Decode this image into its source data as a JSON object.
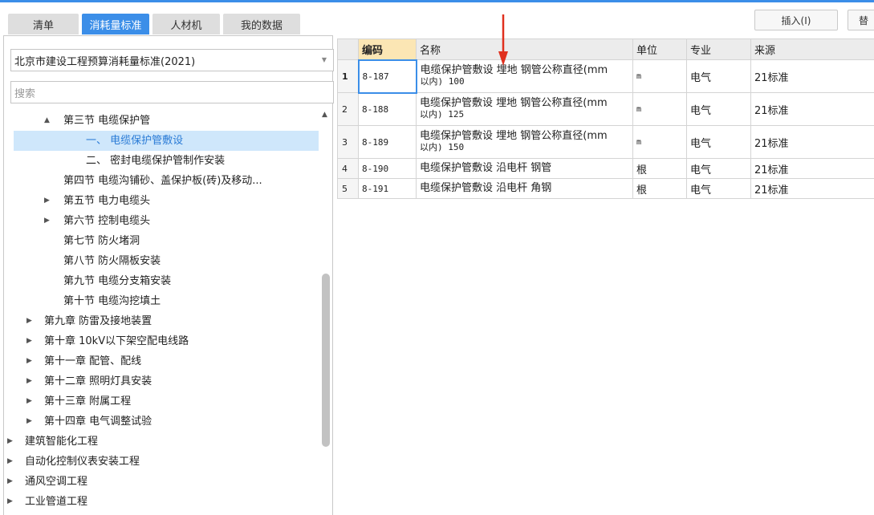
{
  "tabs": [
    "清单",
    "消耗量标准",
    "人材机",
    "我的数据"
  ],
  "active_tab": 1,
  "toolbar": {
    "insert_label": "插入(I)",
    "replace_label": "替"
  },
  "left_panel": {
    "standard_select": "北京市建设工程预算消耗量标准(2021)",
    "search_placeholder": "搜索",
    "tree": [
      {
        "label": "第三节 电缆保护管",
        "arrow": "▲",
        "level": 3,
        "expanded": true
      },
      {
        "label": "一、 电缆保护管敷设",
        "level": 4,
        "selected": true
      },
      {
        "label": "二、 密封电缆保护管制作安装",
        "level": 4
      },
      {
        "label": "第四节 电缆沟铺砂、盖保护板(砖)及移动...",
        "level": 3
      },
      {
        "label": "第五节 电力电缆头",
        "arrow": "▶",
        "level": 3
      },
      {
        "label": "第六节 控制电缆头",
        "arrow": "▶",
        "level": 3
      },
      {
        "label": "第七节 防火堵洞",
        "level": 3
      },
      {
        "label": "第八节 防火隔板安装",
        "level": 3
      },
      {
        "label": "第九节 电缆分支箱安装",
        "level": 3
      },
      {
        "label": "第十节 电缆沟挖填土",
        "level": 3
      },
      {
        "label": "第九章 防雷及接地装置",
        "arrow": "▶",
        "level": 2
      },
      {
        "label": "第十章 10kV以下架空配电线路",
        "arrow": "▶",
        "level": 2
      },
      {
        "label": "第十一章 配管、配线",
        "arrow": "▶",
        "level": 2
      },
      {
        "label": "第十二章 照明灯具安装",
        "arrow": "▶",
        "level": 2
      },
      {
        "label": "第十三章 附属工程",
        "arrow": "▶",
        "level": 2
      },
      {
        "label": "第十四章 电气调整试验",
        "arrow": "▶",
        "level": 2
      },
      {
        "label": "建筑智能化工程",
        "arrow": "▶",
        "level": 1
      },
      {
        "label": "自动化控制仪表安装工程",
        "arrow": "▶",
        "level": 1
      },
      {
        "label": "通风空调工程",
        "arrow": "▶",
        "level": 1
      },
      {
        "label": "工业管道工程",
        "arrow": "▶",
        "level": 1
      }
    ]
  },
  "table": {
    "headers": [
      "编码",
      "名称",
      "单位",
      "专业",
      "来源"
    ],
    "rows": [
      {
        "idx": "1",
        "code": "8-187",
        "name_line1": "电缆保护管敷设 埋地 钢管公称直径(mm",
        "name_line2": "以内) 100",
        "unit": "m",
        "major": "电气",
        "source": "21标准"
      },
      {
        "idx": "2",
        "code": "8-188",
        "name_line1": "电缆保护管敷设 埋地 钢管公称直径(mm",
        "name_line2": "以内) 125",
        "unit": "m",
        "major": "电气",
        "source": "21标准"
      },
      {
        "idx": "3",
        "code": "8-189",
        "name_line1": "电缆保护管敷设 埋地 钢管公称直径(mm",
        "name_line2": "以内) 150",
        "unit": "m",
        "major": "电气",
        "source": "21标准"
      },
      {
        "idx": "4",
        "code": "8-190",
        "name_line1": "电缆保护管敷设 沿电杆 钢管",
        "name_line2": "",
        "unit": "根",
        "major": "电气",
        "source": "21标准"
      },
      {
        "idx": "5",
        "code": "8-191",
        "name_line1": "电缆保护管敷设 沿电杆 角钢",
        "name_line2": "",
        "unit": "根",
        "major": "电气",
        "source": "21标准"
      }
    ]
  },
  "colors": {
    "accent": "#3b8ee8",
    "selected_bg": "#cfe7fb",
    "header_code_bg": "#fbe6b4",
    "annotation_arrow": "#e0301e"
  }
}
